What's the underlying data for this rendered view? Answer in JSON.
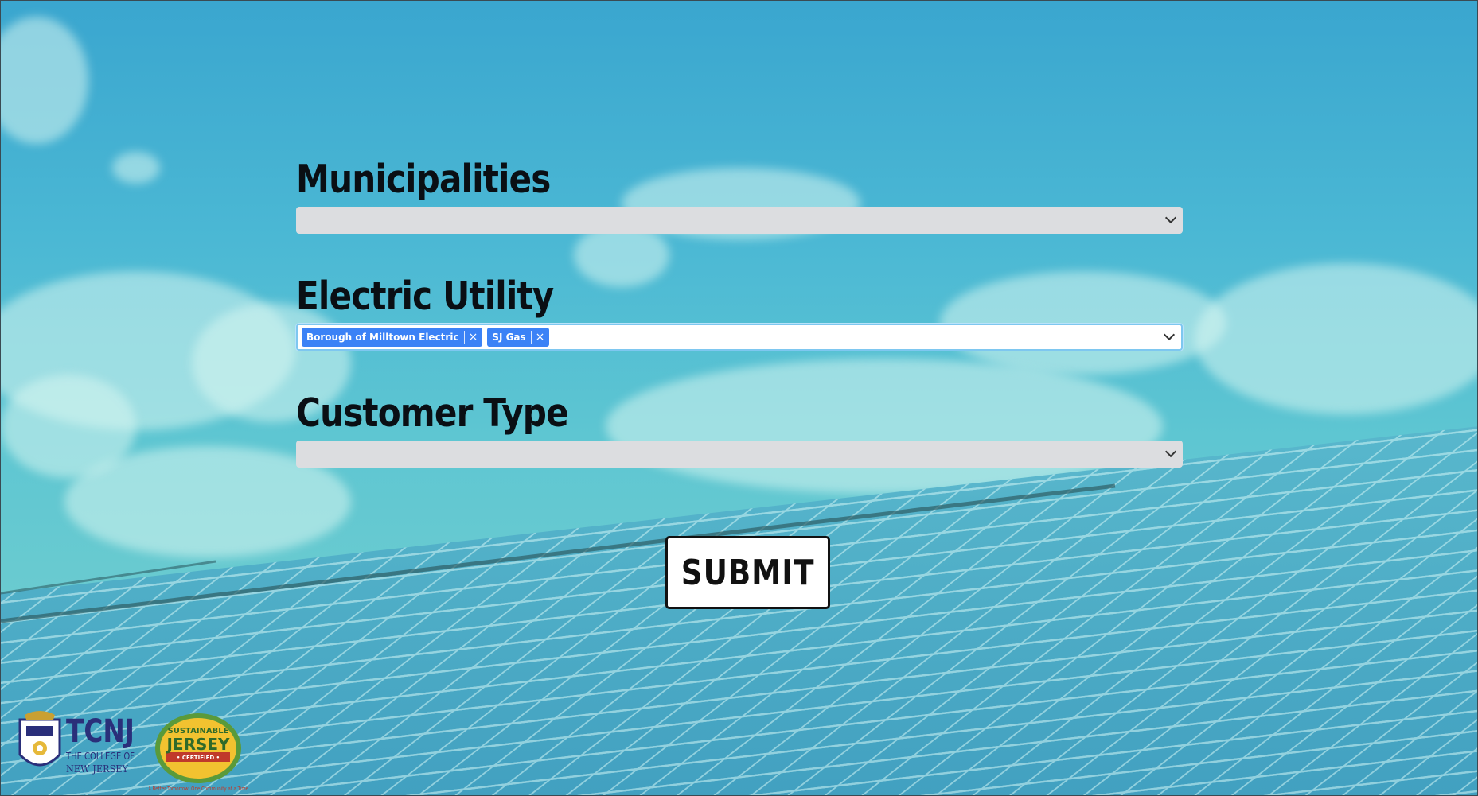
{
  "form": {
    "municipalities": {
      "label": "Municipalities",
      "value": ""
    },
    "electric_utility": {
      "label": "Electric Utility",
      "selected": [
        {
          "text": "Borough of Milltown Electric",
          "remove": "×"
        },
        {
          "text": "SJ Gas",
          "remove": "×"
        }
      ]
    },
    "customer_type": {
      "label": "Customer Type",
      "value": ""
    },
    "submit_label": "SUBMIT"
  },
  "logos": {
    "tcnj": {
      "icon": "tcnj-seal-icon",
      "acronym": "TCNJ",
      "line1": "THE COLLEGE OF",
      "line2": "NEW JERSEY"
    },
    "sustainable_jersey": {
      "icon": "sustainable-jersey-badge-icon",
      "top": "SUSTAINABLE",
      "main": "JERSEY",
      "badge": "• CERTIFIED •",
      "tagline": "A Better Tomorrow, One Community at a Time"
    }
  },
  "colors": {
    "tag_bg": "#3b82f6",
    "select_bg": "#dcdde0",
    "label_color": "#0a0f14",
    "active_border": "#7ec7f0",
    "sky_top": "#3aa6cf",
    "panel_blue": "#4aa8c8"
  }
}
